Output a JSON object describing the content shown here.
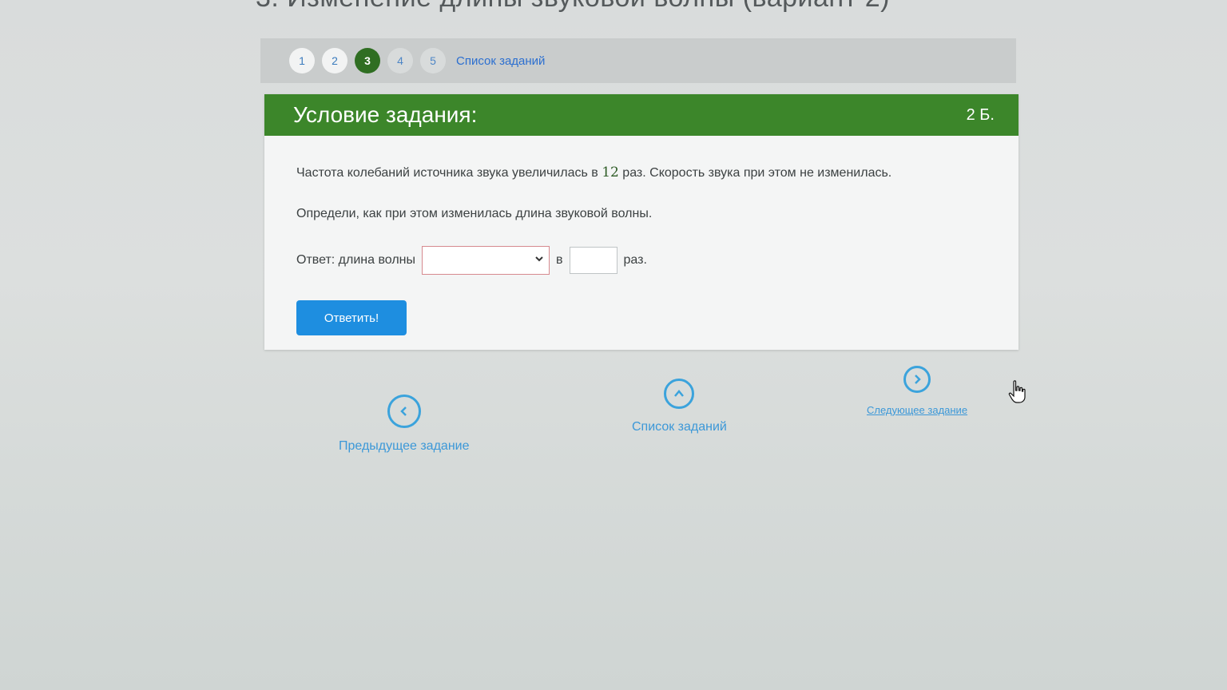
{
  "page": {
    "title": "3. Изменение длины звуковой волны (вариант 2)"
  },
  "task_nav": {
    "items": [
      "1",
      "2",
      "3",
      "4",
      "5"
    ],
    "active": "3",
    "list_link": "Список заданий"
  },
  "task": {
    "header_title": "Условие задания:",
    "points": "2 Б.",
    "line1_before": "Частота колебаний источника звука увеличилась в ",
    "line1_number": "12",
    "line1_after": " раз. Скорость звука при этом не изменилась.",
    "line2": "Определи, как при этом изменилась длина звуковой волны.",
    "answer_label": "Ответ: длина волны",
    "answer_select_value": "",
    "answer_between": "в",
    "answer_input_value": "",
    "answer_suffix": "раз.",
    "submit_label": "Ответить!"
  },
  "bottom_nav": {
    "prev_label": "Предыдущее задание",
    "list_label": "Список заданий",
    "next_label": "Следующее задание"
  },
  "colors": {
    "header_green": "#3c862a",
    "active_step": "#2f6e22",
    "submit_blue": "#1e8ee0",
    "link_blue": "#3c98d8"
  },
  "icons": {
    "prev": "chevron-left-icon",
    "list": "chevron-up-icon",
    "next": "chevron-right-icon",
    "select": "chevron-down-icon",
    "cursor": "hand-cursor-icon"
  }
}
